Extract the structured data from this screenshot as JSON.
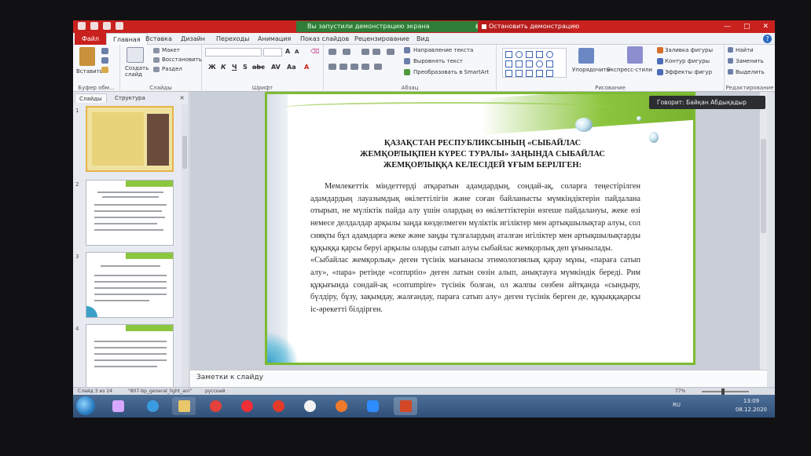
{
  "titlebar": {
    "share_text": "Вы запустили демонстрацию экрана",
    "stop_label": "Остановить демонстрацию",
    "win_min": "—",
    "win_max": "▢",
    "win_close": "✕"
  },
  "ribbon_tabs": [
    "Файл",
    "Главная",
    "Вставка",
    "Дизайн",
    "Переходы",
    "Анимация",
    "Показ слайдов",
    "Рецензирование",
    "Вид"
  ],
  "ribbon": {
    "paste_label": "Вставить",
    "clipboard_group": "Буфер обм...",
    "create_slide_label": "Создать слайд",
    "layout_label": "Макет",
    "reset_label": "Восстановить",
    "section_label": "Раздел",
    "slides_group": "Слайды",
    "font_group": "Шрифт",
    "paragraph_group": "Абзац",
    "text_direction": "Направление текста",
    "align_text": "Выровнять текст",
    "smartart": "Преобразовать в SmartArt",
    "arrange_label": "Упорядочить",
    "quick_styles_label": "Экспресс-стили",
    "shape_fill": "Заливка фигуры",
    "shape_outline": "Контур фигуры",
    "shape_effects": "Эффекты фигур",
    "drawing_group": "Рисование",
    "find_label": "Найти",
    "replace_label": "Заменить",
    "select_label": "Выделить",
    "editing_group": "Редактирование"
  },
  "left_panel": {
    "tab_slides": "Слайды",
    "tab_outline": "Структура",
    "close": "×",
    "slide_numbers": [
      "1",
      "2",
      "3",
      "4"
    ]
  },
  "slide": {
    "title_line1": "ҚАЗАҚСТАН РЕСПУБЛИКСЫНЫҢ «СЫБАЙЛАС",
    "title_line2": "ЖЕМҚОРЛЫҚПЕН КҮРЕС ТУРАЛЫ» ЗАҢЫНДА СЫБАЙЛАС",
    "title_line3": "ЖЕМҚОРЛЫҚҚА КЕЛЕСІДЕЙ ҰҒЫМ БЕРІЛГЕН:",
    "para1": "Мемлекеттік міндеттерді атқаратын адамдардың, сондай-ақ, соларға теңестірілген адамдардың лауазымдық өкілеттілігін және соған байланысты мүмкіндіктерін пайдалана отырып, не мүліктік пайда алу үшін олардың өз өкілеттіктерін өзгеше пайдалануы, жеке өзі немесе делдалдар арқылы заңда көзделмеген мүліктік игіліктер мен артықшылықтар алуы, сол сияқты бұл адамдарға жеке және заңды тұлғалардың аталған игіліктер мен артықшылықтарды құқыққа қарсы беруі арқылы оларды сатып алуы сыбайлас жемқорлық деп ұғынылады.",
    "para2": "«Сыбайлас жемқорлық» деген түсінік мағынасы этимологиялық қарау мұны, «параға сатып алу», «пара» ретінде «corruptio» деген латын сөзін алып, анықтауға мүмкіндік береді. Рим құқығында сондай-ақ «corrumpire» түсінік болған, ол жалпы сөзбен айтқанда «сындыру, бүлдіру, бұзу, зақымдау, жалғандау, параға сатып алу» деген түсінік берген де, құқыққақарсы іс-әрекетті білдірген."
  },
  "tooltip": "Говорит: Байқан Абдықадыр",
  "notes_placeholder": "Заметки к слайду",
  "statusbar": {
    "slide_info": "Слайд 3 из 24",
    "theme": "\"807-bp_general_light_ani\"",
    "language": "русский",
    "zoom": "77%"
  },
  "taskbar": {
    "lang": "RU",
    "time": "13:09",
    "date": "08.12.2020"
  },
  "colors": {
    "accent_red": "#c9211e",
    "share_green": "#2f7d38",
    "slide_green": "#7dbb32"
  }
}
